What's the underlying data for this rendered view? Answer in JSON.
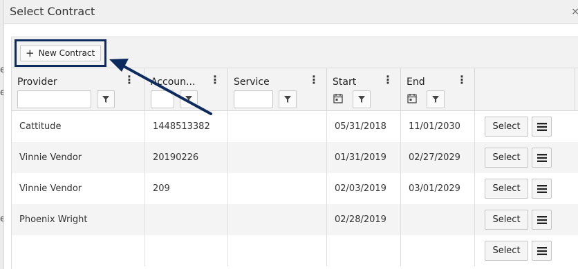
{
  "dialog": {
    "title": "Select Contract",
    "close_glyph": "×"
  },
  "toolbar": {
    "new_contract_label": "New Contract",
    "plus_glyph": "+"
  },
  "columns": [
    {
      "label": "Provider"
    },
    {
      "label": "Accoun..."
    },
    {
      "label": "Service"
    },
    {
      "label": "Start"
    },
    {
      "label": "End"
    }
  ],
  "menu_glyph": "⋮",
  "rows": [
    {
      "provider": "Cattitude",
      "account": "1448513382",
      "service": "",
      "start": "05/31/2018",
      "end": "11/01/2030",
      "select_label": "Select"
    },
    {
      "provider": "Vinnie Vendor",
      "account": "20190226",
      "service": "",
      "start": "01/31/2019",
      "end": "02/27/2029",
      "select_label": "Select"
    },
    {
      "provider": "Vinnie Vendor",
      "account": "209",
      "service": "",
      "start": "02/03/2019",
      "end": "03/01/2029",
      "select_label": "Select"
    },
    {
      "provider": "Phoenix Wright",
      "account": "",
      "service": "",
      "start": "02/28/2019",
      "end": "",
      "select_label": "Select"
    },
    {
      "provider": "",
      "account": "",
      "service": "",
      "start": "",
      "end": "",
      "select_label": "Select"
    }
  ],
  "colors": {
    "annotation": "#0d2a5e"
  }
}
